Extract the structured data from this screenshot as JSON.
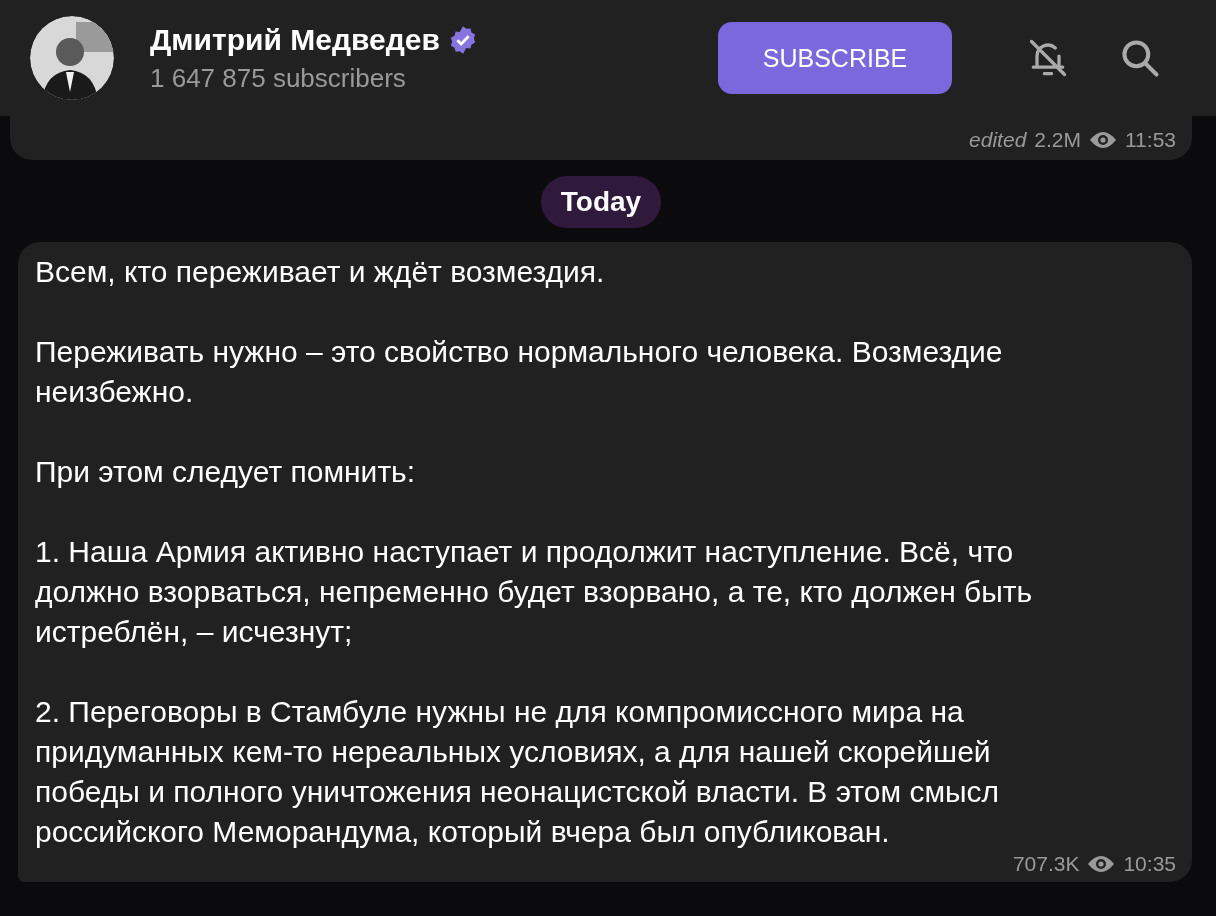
{
  "header": {
    "title": "Дмитрий Медведев",
    "verified": true,
    "subtitle": "1 647 875 subscribers",
    "subscribe_button": "SUBSCRIBE"
  },
  "messages": [
    {
      "kind": "message",
      "edited": "edited",
      "views": "2.2M",
      "time": "11:53"
    },
    {
      "kind": "date",
      "label": "Today"
    },
    {
      "kind": "message",
      "paragraphs": [
        [
          "Всем, кто переживает и ждёт возмездия."
        ],
        [
          "Переживать нужно – это свойство нормального человека. Возмездие",
          "неизбежно."
        ],
        [
          "При этом следует помнить:"
        ],
        [
          "1. Наша Армия активно наступает и продолжит наступление. Всё, что",
          "должно взорваться, непременно будет взорвано, а те, кто должен быть",
          "истреблён, – исчезнут;"
        ],
        [
          "2. Переговоры в Стамбуле нужны не для компромиссного мира на",
          "придуманных кем-то нереальных условиях, а для нашей скорейшей",
          "победы и полного уничтожения неонацистской власти. В этом смысл",
          "российского Меморандума, который вчера был опубликован."
        ]
      ],
      "views": "707.3K",
      "time": "10:35"
    }
  ]
}
